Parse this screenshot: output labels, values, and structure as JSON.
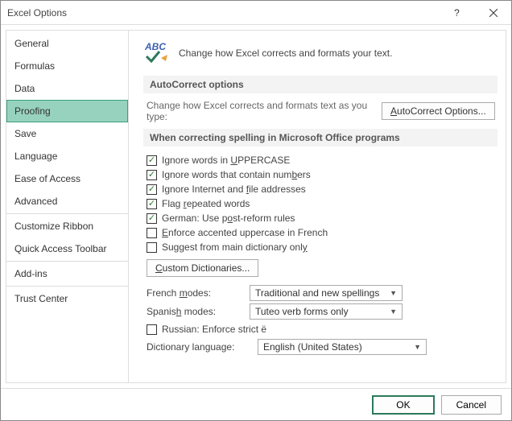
{
  "window": {
    "title": "Excel Options"
  },
  "sidebar": {
    "items": [
      {
        "label": "General"
      },
      {
        "label": "Formulas"
      },
      {
        "label": "Data"
      },
      {
        "label": "Proofing",
        "selected": true
      },
      {
        "label": "Save"
      },
      {
        "label": "Language"
      },
      {
        "label": "Ease of Access"
      },
      {
        "label": "Advanced"
      },
      {
        "label": "Customize Ribbon"
      },
      {
        "label": "Quick Access Toolbar"
      },
      {
        "label": "Add-ins"
      },
      {
        "label": "Trust Center"
      }
    ]
  },
  "main": {
    "header_text": "Change how Excel corrects and formats your text.",
    "autocorrect_section": "AutoCorrect options",
    "autocorrect_desc": "Change how Excel corrects and formats text as you type:",
    "autocorrect_btn_pre": "A",
    "autocorrect_btn_rest": "utoCorrect Options...",
    "spelling_section": "When correcting spelling in Microsoft Office programs",
    "checks": [
      {
        "pre": "Ignore words in ",
        "u": "U",
        "post": "PPERCASE",
        "checked": true
      },
      {
        "pre": "Ignore words that contain num",
        "u": "b",
        "post": "ers",
        "checked": true
      },
      {
        "pre": "Ignore Internet and ",
        "u": "f",
        "post": "ile addresses",
        "checked": true
      },
      {
        "pre": "Flag ",
        "u": "r",
        "post": "epeated words",
        "checked": true
      },
      {
        "pre": "German: Use p",
        "u": "o",
        "post": "st-reform rules",
        "checked": true
      },
      {
        "pre": "",
        "u": "E",
        "post": "nforce accented uppercase in French",
        "checked": false
      },
      {
        "pre": "Suggest from main dictionary onl",
        "u": "y",
        "post": "",
        "checked": false
      }
    ],
    "custom_dict_pre": "C",
    "custom_dict_rest": "ustom Dictionaries...",
    "french_label_pre": "French ",
    "french_label_u": "m",
    "french_label_post": "odes:",
    "french_value": "Traditional and new spellings",
    "spanish_label_pre": "Spanis",
    "spanish_label_u": "h",
    "spanish_label_post": " modes:",
    "spanish_value": "Tuteo verb forms only",
    "russian_label": "Russian: Enforce strict ё",
    "dict_lang_label_pre": "Dictionary language",
    "dict_lang_label_post": ":",
    "dict_lang_value": "English (United States)"
  },
  "footer": {
    "ok": "OK",
    "cancel": "Cancel"
  }
}
